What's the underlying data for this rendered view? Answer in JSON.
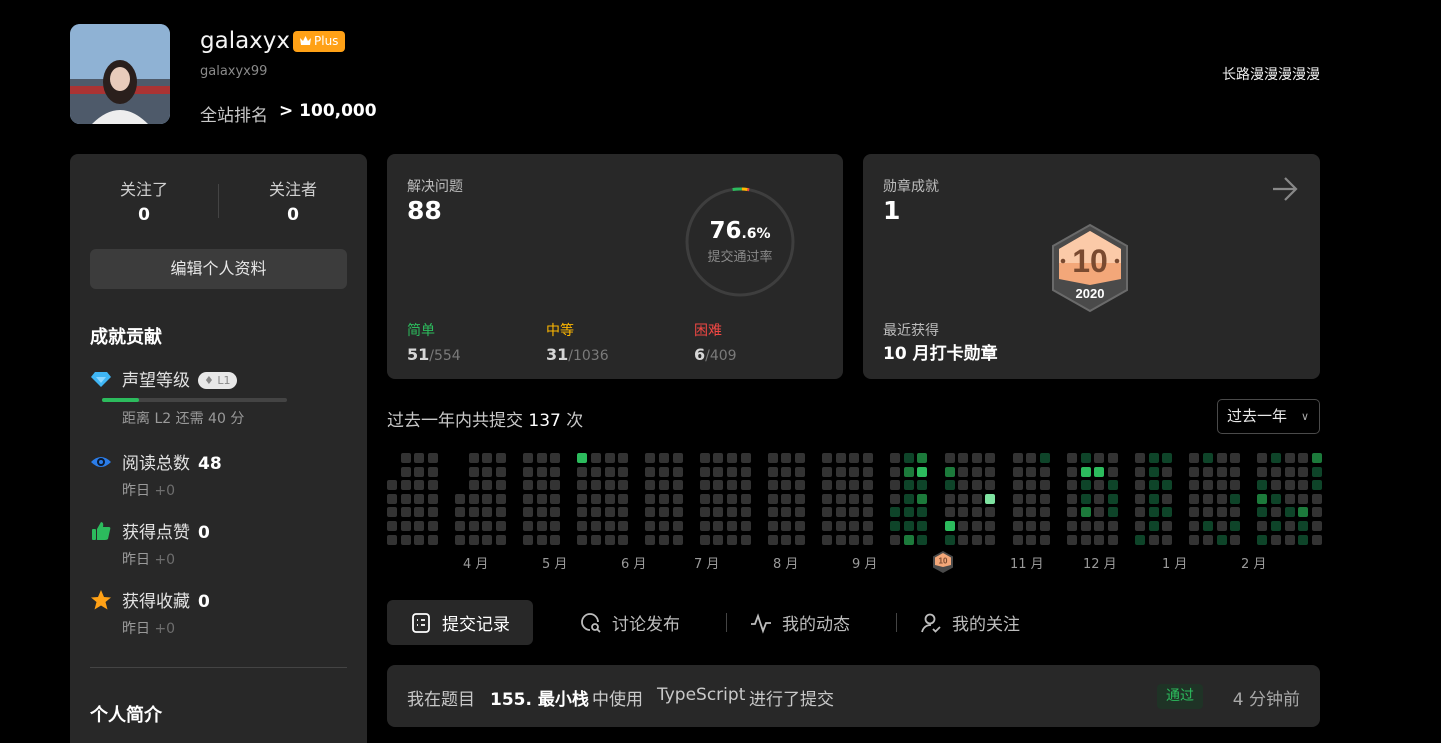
{
  "profile": {
    "username": "galaxyx",
    "plus_label": "Plus",
    "handle": "galaxyx99",
    "rank_label": "全站排名",
    "rank_value": "> 100,000",
    "motto": "长路漫漫漫漫漫"
  },
  "sidebar": {
    "following_label": "关注了",
    "following_count": "0",
    "followers_label": "关注者",
    "followers_count": "0",
    "edit_button": "编辑个人资料",
    "achievements_title": "成就贡献",
    "reputation": {
      "label": "声望等级",
      "level": "L1",
      "progress_fraction": 0.2,
      "sub": "距离 L2 还需 40 分"
    },
    "views": {
      "label": "阅读总数",
      "value": "48",
      "sub_prefix": "昨日",
      "sub_delta": "+0"
    },
    "likes": {
      "label": "获得点赞",
      "value": "0",
      "sub_prefix": "昨日",
      "sub_delta": "+0"
    },
    "favorites": {
      "label": "获得收藏",
      "value": "0",
      "sub_prefix": "昨日",
      "sub_delta": "+0"
    },
    "bio_title": "个人简介"
  },
  "solved_card": {
    "label": "解决问题",
    "value": "88",
    "acceptance_value": "76",
    "acceptance_decimal": ".6%",
    "acceptance_fraction": 0.766,
    "acceptance_label": "提交通过率",
    "easy": {
      "label": "简单",
      "solved": "51",
      "total": "/554",
      "color": "#2cbb5d"
    },
    "medium": {
      "label": "中等",
      "solved": "31",
      "total": "/1036",
      "color": "#ffb800"
    },
    "hard": {
      "label": "困难",
      "solved": "6",
      "total": "/409",
      "color": "#ef4743"
    }
  },
  "badge_card": {
    "label": "勋章成就",
    "value": "1",
    "badge_number": "10",
    "badge_year": "2020",
    "recent_label": "最近获得",
    "recent_badge": "10 月打卡勋章"
  },
  "submissions": {
    "title_prefix": "过去一年内共提交",
    "count": "137",
    "title_suffix": "次",
    "range_selected": "过去一年",
    "months": [
      "4 月",
      "5 月",
      "6 月",
      "7 月",
      "8 月",
      "9 月",
      "11 月",
      "12 月",
      "1 月",
      "2 月"
    ]
  },
  "tabs": [
    {
      "label": "提交记录",
      "icon": "checklist-icon",
      "active": true
    },
    {
      "label": "讨论发布",
      "icon": "chat-search-icon",
      "active": false
    },
    {
      "label": "我的动态",
      "icon": "activity-icon",
      "active": false
    },
    {
      "label": "我的关注",
      "icon": "user-check-icon",
      "active": false
    }
  ],
  "recent_submission": {
    "prefix": "我在题目",
    "problem": "155. 最小栈",
    "middle": "中使用",
    "language": "TypeScript",
    "suffix": "进行了提交",
    "status": "通过",
    "time": "4 分钟前"
  },
  "colors": {
    "accent": "#ffa116",
    "easy": "#2cbb5d",
    "medium": "#ffb800",
    "hard": "#ef4743"
  }
}
